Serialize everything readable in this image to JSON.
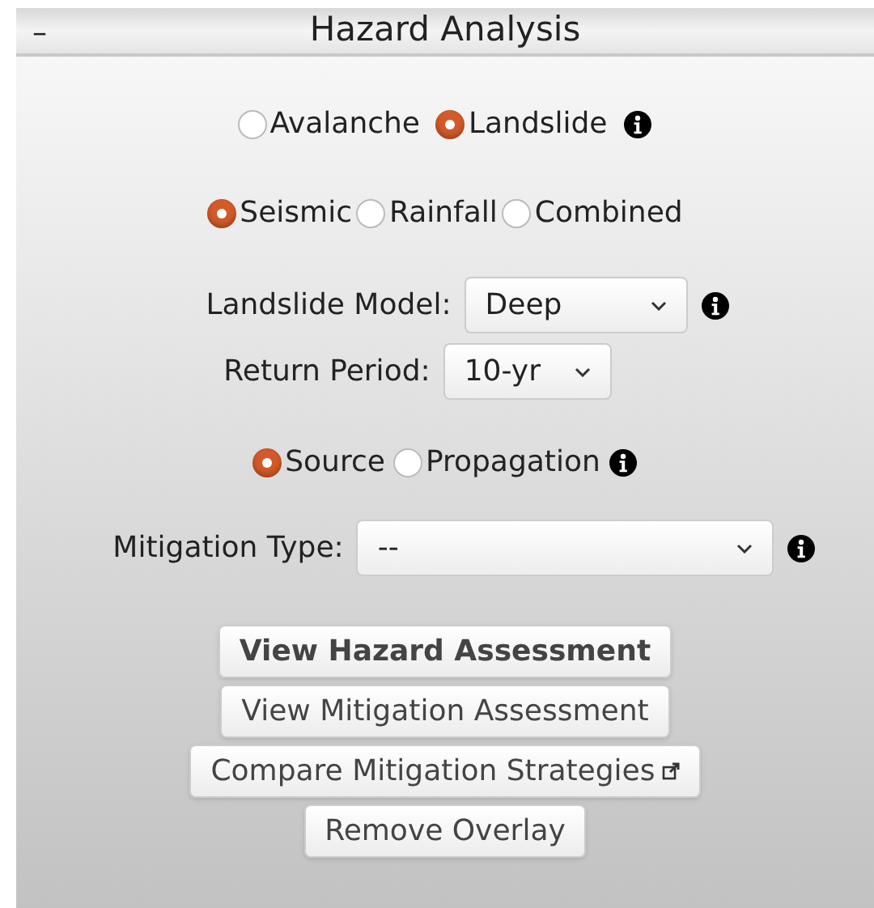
{
  "panel": {
    "collapse_symbol": "–",
    "title": "Hazard Analysis"
  },
  "hazard_type": {
    "options": [
      {
        "label": "Avalanche",
        "selected": false
      },
      {
        "label": "Landslide",
        "selected": true
      }
    ],
    "info": true
  },
  "trigger": {
    "options": [
      {
        "label": "Seismic",
        "selected": true
      },
      {
        "label": "Rainfall",
        "selected": false
      },
      {
        "label": "Combined",
        "selected": false
      }
    ],
    "info": false
  },
  "landslide_model": {
    "label": "Landslide Model:",
    "value": "Deep",
    "info": true
  },
  "return_period": {
    "label": "Return Period:",
    "value": "10-yr",
    "info": false
  },
  "phase": {
    "options": [
      {
        "label": "Source",
        "selected": true
      },
      {
        "label": "Propagation",
        "selected": false
      }
    ],
    "info": true
  },
  "mitigation_type": {
    "label": "Mitigation Type:",
    "value": "--",
    "info": true
  },
  "buttons": [
    {
      "label": "View Hazard Assessment",
      "kind": "primary"
    },
    {
      "label": "View Mitigation Assessment",
      "kind": "default"
    },
    {
      "label": "Compare Mitigation Strategies",
      "kind": "external"
    },
    {
      "label": "Remove Overlay",
      "kind": "default"
    }
  ]
}
